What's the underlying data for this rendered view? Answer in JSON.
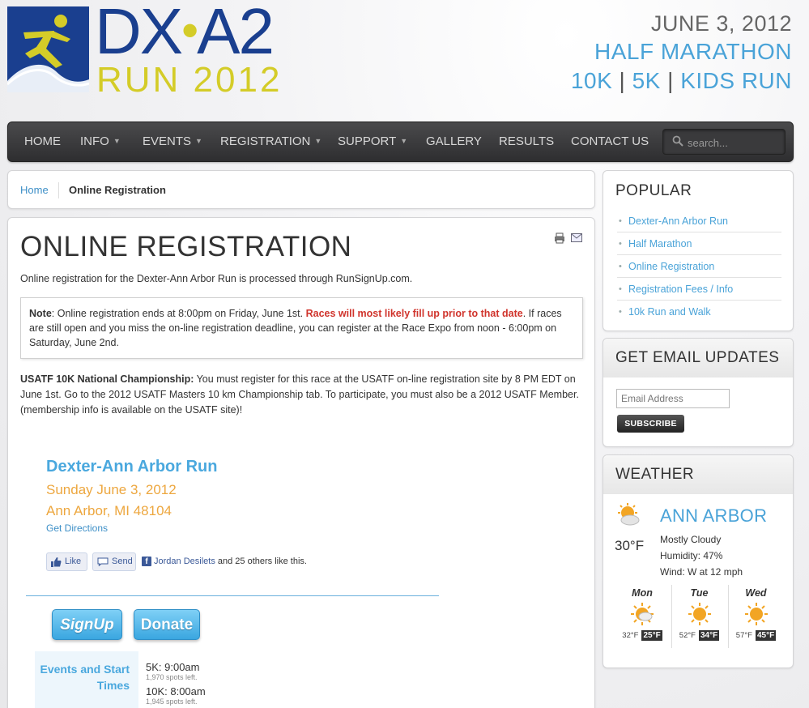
{
  "logo": {
    "top": "DX",
    "dot": "•",
    "top2": "A2",
    "bottom": "RUN 2012"
  },
  "header": {
    "date": "JUNE 3, 2012",
    "line1": "HALF MARATHON",
    "line2": [
      "10K",
      "5K",
      "KIDS RUN"
    ],
    "separator": "|"
  },
  "nav": {
    "items": [
      "HOME",
      "INFO",
      "EVENTS",
      "REGISTRATION",
      "SUPPORT",
      "GALLERY",
      "RESULTS",
      "CONTACT US"
    ],
    "caret": "⌄",
    "search_placeholder": "search..."
  },
  "breadcrumb": {
    "home": "Home",
    "current": "Online Registration"
  },
  "main": {
    "title": "ONLINE REGISTRATION",
    "intro": "Online registration for the Dexter-Ann Arbor Run is processed through RunSignUp.com.",
    "note": {
      "label": "Note",
      "text1": ": Online registration ends at 8:00pm on Friday, June 1st. ",
      "red": "Races will most likely fill up prior to that date",
      "text2": ". If races are still open and you miss the on-line registration deadline, you can register at the Race Expo from noon - 6:00pm on Saturday, June 2nd."
    },
    "usatf": {
      "label": "USATF 10K National Championship:",
      "text": " You must register for this race at the USATF on-line registration site by 8 PM EDT on June 1st. Go to the 2012 USATF Masters 10 km Championship tab. To participate, you must also be a 2012 USATF Member. (membership info is available on the USATF site)!"
    },
    "event": {
      "name": "Dexter-Ann Arbor Run",
      "date": "Sunday June 3, 2012",
      "location": "Ann Arbor, MI 48104",
      "directions": "Get Directions"
    },
    "facebook": {
      "like": "Like",
      "send": "Send",
      "f": "f",
      "name": "Jordan Desilets",
      "rest": " and 25 others like this."
    },
    "buttons": {
      "signup": "SignUp",
      "donate": "Donate"
    },
    "events_label": "Events and Start Times",
    "events": [
      {
        "time": "5K: 9:00am",
        "spots": "1,970 spots left."
      },
      {
        "time": "10K: 8:00am",
        "spots": "1,945 spots left."
      }
    ]
  },
  "sidebar": {
    "popular": {
      "title": "POPULAR",
      "items": [
        "Dexter-Ann Arbor Run",
        "Half Marathon",
        "Online Registration",
        "Registration Fees / Info",
        "10k Run and Walk"
      ]
    },
    "email": {
      "title": "GET EMAIL UPDATES",
      "placeholder": "Email Address",
      "button": "SUBSCRIBE"
    },
    "weather": {
      "title": "WEATHER",
      "city": "ANN ARBOR",
      "temp": "30°F",
      "condition": "Mostly Cloudy",
      "humidity": "Humidity: 47%",
      "wind": "Wind: W at 12 mph",
      "forecast": [
        {
          "day": "Mon",
          "hi": "32°F",
          "lo": "25°F",
          "icon": "partly-cloudy-icon"
        },
        {
          "day": "Tue",
          "hi": "52°F",
          "lo": "34°F",
          "icon": "sun-icon"
        },
        {
          "day": "Wed",
          "hi": "57°F",
          "lo": "45°F",
          "icon": "sun-icon"
        }
      ]
    }
  },
  "colors": {
    "accent_blue": "#4aa3d8",
    "logo_navy": "#1a3f8f",
    "logo_yellow": "#d4cc28",
    "orange": "#eda73f",
    "red": "#d0342c"
  }
}
